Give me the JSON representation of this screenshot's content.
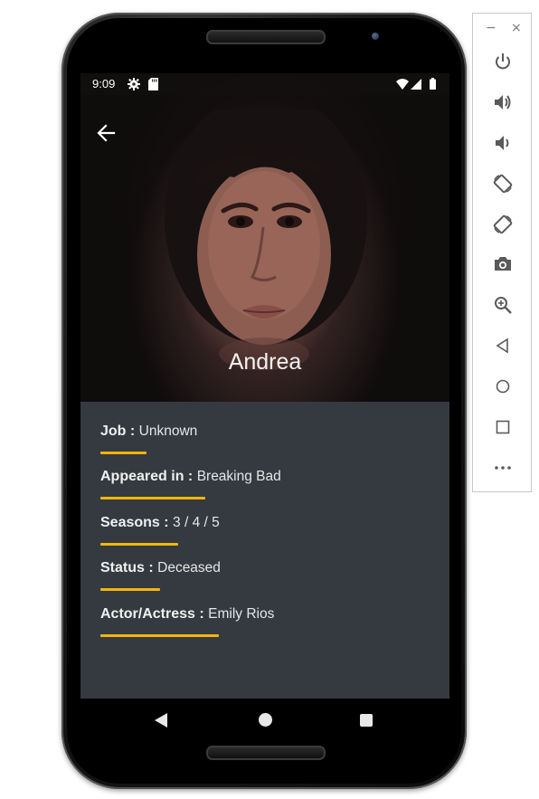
{
  "status_bar": {
    "time": "9:09",
    "icons": [
      "gear-icon",
      "sd-card-icon",
      "wifi-icon",
      "signal-icon",
      "battery-icon"
    ]
  },
  "header": {
    "name": "Andrea",
    "back_icon": "arrow-left-icon"
  },
  "details": [
    {
      "label": "Job :",
      "value": "Unknown"
    },
    {
      "label": "Appeared in :",
      "value": "Breaking Bad"
    },
    {
      "label": "Seasons :",
      "value": "3 / 4 / 5"
    },
    {
      "label": "Status :",
      "value": "Deceased"
    },
    {
      "label": "Actor/Actress :",
      "value": "Emily Rios"
    }
  ],
  "nav_bar": {
    "icons": [
      "nav-back-icon",
      "nav-home-icon",
      "nav-recents-icon"
    ]
  },
  "emulator_panel": {
    "minimize_label": "−",
    "close_label": "×",
    "buttons": [
      "power-icon",
      "volume-up-icon",
      "volume-down-icon",
      "rotate-left-icon",
      "rotate-right-icon",
      "camera-icon",
      "zoom-icon",
      "back-icon",
      "home-icon",
      "overview-icon",
      "more-icon"
    ]
  },
  "colors": {
    "accent": "#f5b50a",
    "background": "#353a41",
    "text": "#f0f0f0"
  }
}
